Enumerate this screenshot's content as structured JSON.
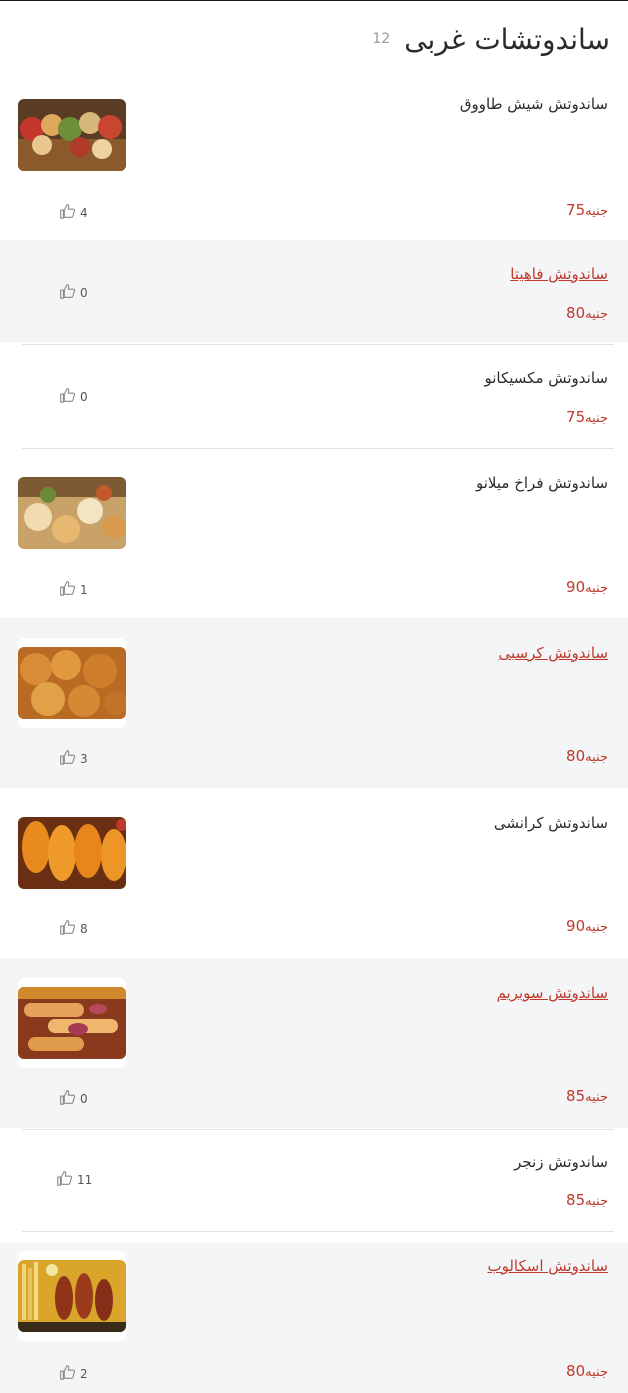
{
  "header": {
    "title": "ساندوتشات غربى",
    "count": "12"
  },
  "currency": "جنيه",
  "items": [
    {
      "name": "ساندوتش شيش طاووق",
      "price": "75",
      "likes": "4",
      "image": "shish-tawook-photo"
    },
    {
      "name": "ساندوتش فاهيتا",
      "price": "80",
      "likes": "0"
    },
    {
      "name": "ساندوتش مكسيكانو",
      "price": "75",
      "likes": "0"
    },
    {
      "name": "ساندوتش فراخ ميلانو",
      "price": "90",
      "likes": "1",
      "image": "milano-chicken-photo"
    },
    {
      "name": "ساندوتش كرسبى",
      "price": "80",
      "likes": "3",
      "image": "crispy-chicken-photo"
    },
    {
      "name": "ساندوتش كرانشى",
      "price": "90",
      "likes": "8",
      "image": "crunchy-chicken-photo"
    },
    {
      "name": "ساندوتش سوبريم",
      "price": "85",
      "likes": "0",
      "image": "supreme-rolls-photo"
    },
    {
      "name": "ساندوتش زنجر",
      "price": "85",
      "likes": "11"
    },
    {
      "name": "ساندوتش اسكالوب",
      "price": "80",
      "likes": "2",
      "image": "escalope-fries-photo"
    }
  ],
  "colors": {
    "accent": "#c0392b",
    "alt_row": "#f4f5f7",
    "text": "#2b2b2b"
  },
  "icons": {
    "like": "thumbs-up-icon"
  }
}
